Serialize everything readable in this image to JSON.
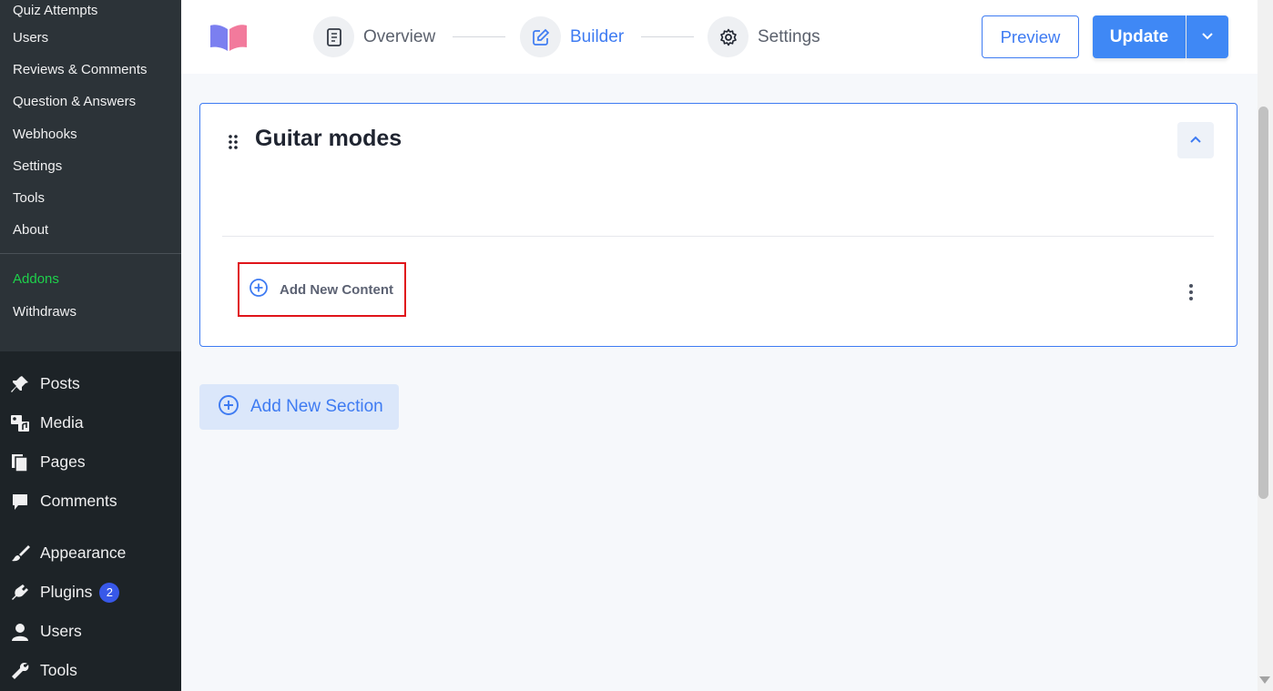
{
  "sidebar": {
    "submenu": [
      {
        "label": "Quiz Attempts"
      },
      {
        "label": "Users"
      },
      {
        "label": "Reviews & Comments"
      },
      {
        "label": "Question & Answers"
      },
      {
        "label": "Webhooks"
      },
      {
        "label": "Settings"
      },
      {
        "label": "Tools"
      },
      {
        "label": "About"
      }
    ],
    "addons": "Addons",
    "withdraws": "Withdraws",
    "menu": [
      {
        "label": "Posts",
        "icon": "pin-icon"
      },
      {
        "label": "Media",
        "icon": "media-icon"
      },
      {
        "label": "Pages",
        "icon": "pages-icon"
      },
      {
        "label": "Comments",
        "icon": "comment-icon"
      },
      {
        "label": "Appearance",
        "icon": "brush-icon"
      },
      {
        "label": "Plugins",
        "icon": "plugin-icon",
        "badge": "2"
      },
      {
        "label": "Users",
        "icon": "user-icon"
      },
      {
        "label": "Tools",
        "icon": "wrench-icon"
      }
    ],
    "addons_color": "#1ed14b"
  },
  "header": {
    "steps": [
      {
        "label": "Overview",
        "icon": "document-icon",
        "active": false
      },
      {
        "label": "Builder",
        "icon": "edit-icon",
        "active": true
      },
      {
        "label": "Settings",
        "icon": "gear-icon",
        "active": false
      }
    ],
    "preview_label": "Preview",
    "update_label": "Update",
    "accent": "#3e7bf2"
  },
  "section": {
    "title": "Guitar modes",
    "add_content_label": "Add New Content"
  },
  "add_section_label": "Add New Section"
}
